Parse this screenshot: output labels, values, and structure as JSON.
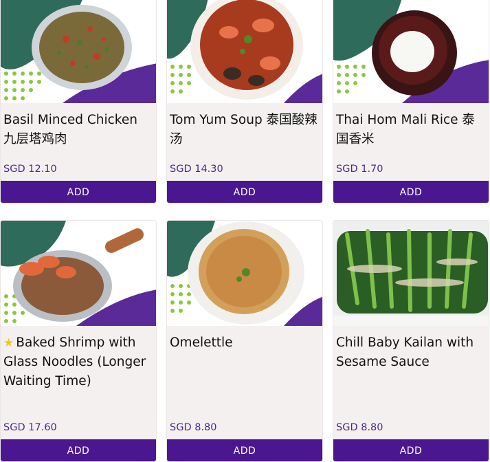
{
  "colors": {
    "accent": "#4a1791",
    "price": "#4b2a8a",
    "card_bg": "#f4f0f0",
    "blob_green": "#2e6b5a",
    "blob_purple": "#5a2a98",
    "dots": "#8cc63f"
  },
  "items": [
    {
      "name": "Basil Minced Chicken 九层塔鸡肉",
      "featured": false,
      "price": "SGD 12.10",
      "button": "ADD",
      "image": "basil-chicken-plate"
    },
    {
      "name": "Tom Yum Soup 泰国酸辣汤",
      "featured": false,
      "price": "SGD 14.30",
      "button": "ADD",
      "image": "tom-yum-bowl"
    },
    {
      "name": "Thai Hom Mali Rice 泰国香米",
      "featured": false,
      "price": "SGD 1.70",
      "button": "ADD",
      "image": "rice-bowl"
    },
    {
      "name": "Baked Shrimp with Glass Noodles (Longer Waiting Time)",
      "featured": true,
      "price": "SGD 17.60",
      "button": "ADD",
      "image": "shrimp-noodle-pan"
    },
    {
      "name": "Omelettle",
      "featured": false,
      "price": "SGD 8.80",
      "button": "ADD",
      "image": "omelette-plate"
    },
    {
      "name": "Chill Baby Kailan with Sesame Sauce",
      "featured": false,
      "price": "SGD 8.80",
      "button": "ADD",
      "image": "kailan-plate"
    }
  ]
}
